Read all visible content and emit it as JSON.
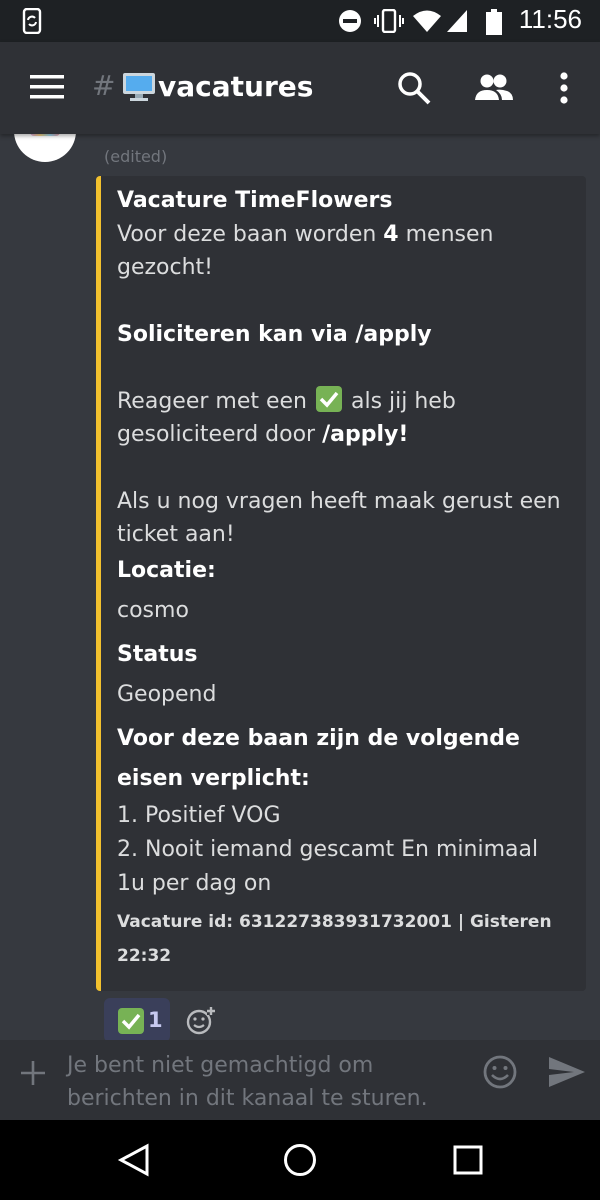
{
  "status_bar": {
    "time": "11:56",
    "icons": [
      "phone-sync-icon",
      "do-not-disturb-icon",
      "vibrate-icon",
      "wifi-icon",
      "cell-signal-icon",
      "battery-icon"
    ]
  },
  "header": {
    "hash": "#",
    "channel_emoji": "desktop-computer-emoji",
    "channel_name": "vacatures",
    "icons": [
      "menu-icon",
      "search-icon",
      "members-icon",
      "more-vertical-icon"
    ]
  },
  "message": {
    "edited_label": "(edited)",
    "embed": {
      "accent_color": "#f2c12e",
      "title": "Vacature TimeFlowers",
      "desc_line1_pre": "Voor deze baan worden ",
      "desc_line1_bold": "4",
      "desc_line1_post": " mensen gezocht!",
      "apply_line": "Soliciteren kan via /apply",
      "react_pre": "Reageer met een ",
      "react_mid": " als jij heb gesoliciteerd door ",
      "react_bold": "/apply!",
      "questions_line": "Als u nog vragen heeft maak gerust een ticket aan!",
      "fields": [
        {
          "name": "Locatie:",
          "value": "cosmo"
        },
        {
          "name": "Status",
          "value": "Geopend"
        }
      ],
      "requirements_title": "Voor deze baan zijn de volgende eisen verplicht:",
      "requirements": [
        "1. Positief VOG",
        "2. Nooit iemand gescamt En minimaal 1u per dag on"
      ],
      "footer": "Vacature id: 631227383931732001 | Gisteren 22:32"
    },
    "reactions": [
      {
        "emoji": "white-check-mark-emoji",
        "count": "1"
      }
    ]
  },
  "input": {
    "placeholder": "Je bent niet gemachtigd om berichten in dit kanaal te sturen."
  },
  "nav_bar": {
    "icons": [
      "back-icon",
      "home-icon",
      "recents-icon"
    ]
  },
  "colors": {
    "background": "#36393f",
    "header": "#2f3136",
    "embed_bg": "#2f3136",
    "accent": "#f2c12e",
    "reaction_bg": "#3a3f5a",
    "check_green": "#77b255"
  }
}
